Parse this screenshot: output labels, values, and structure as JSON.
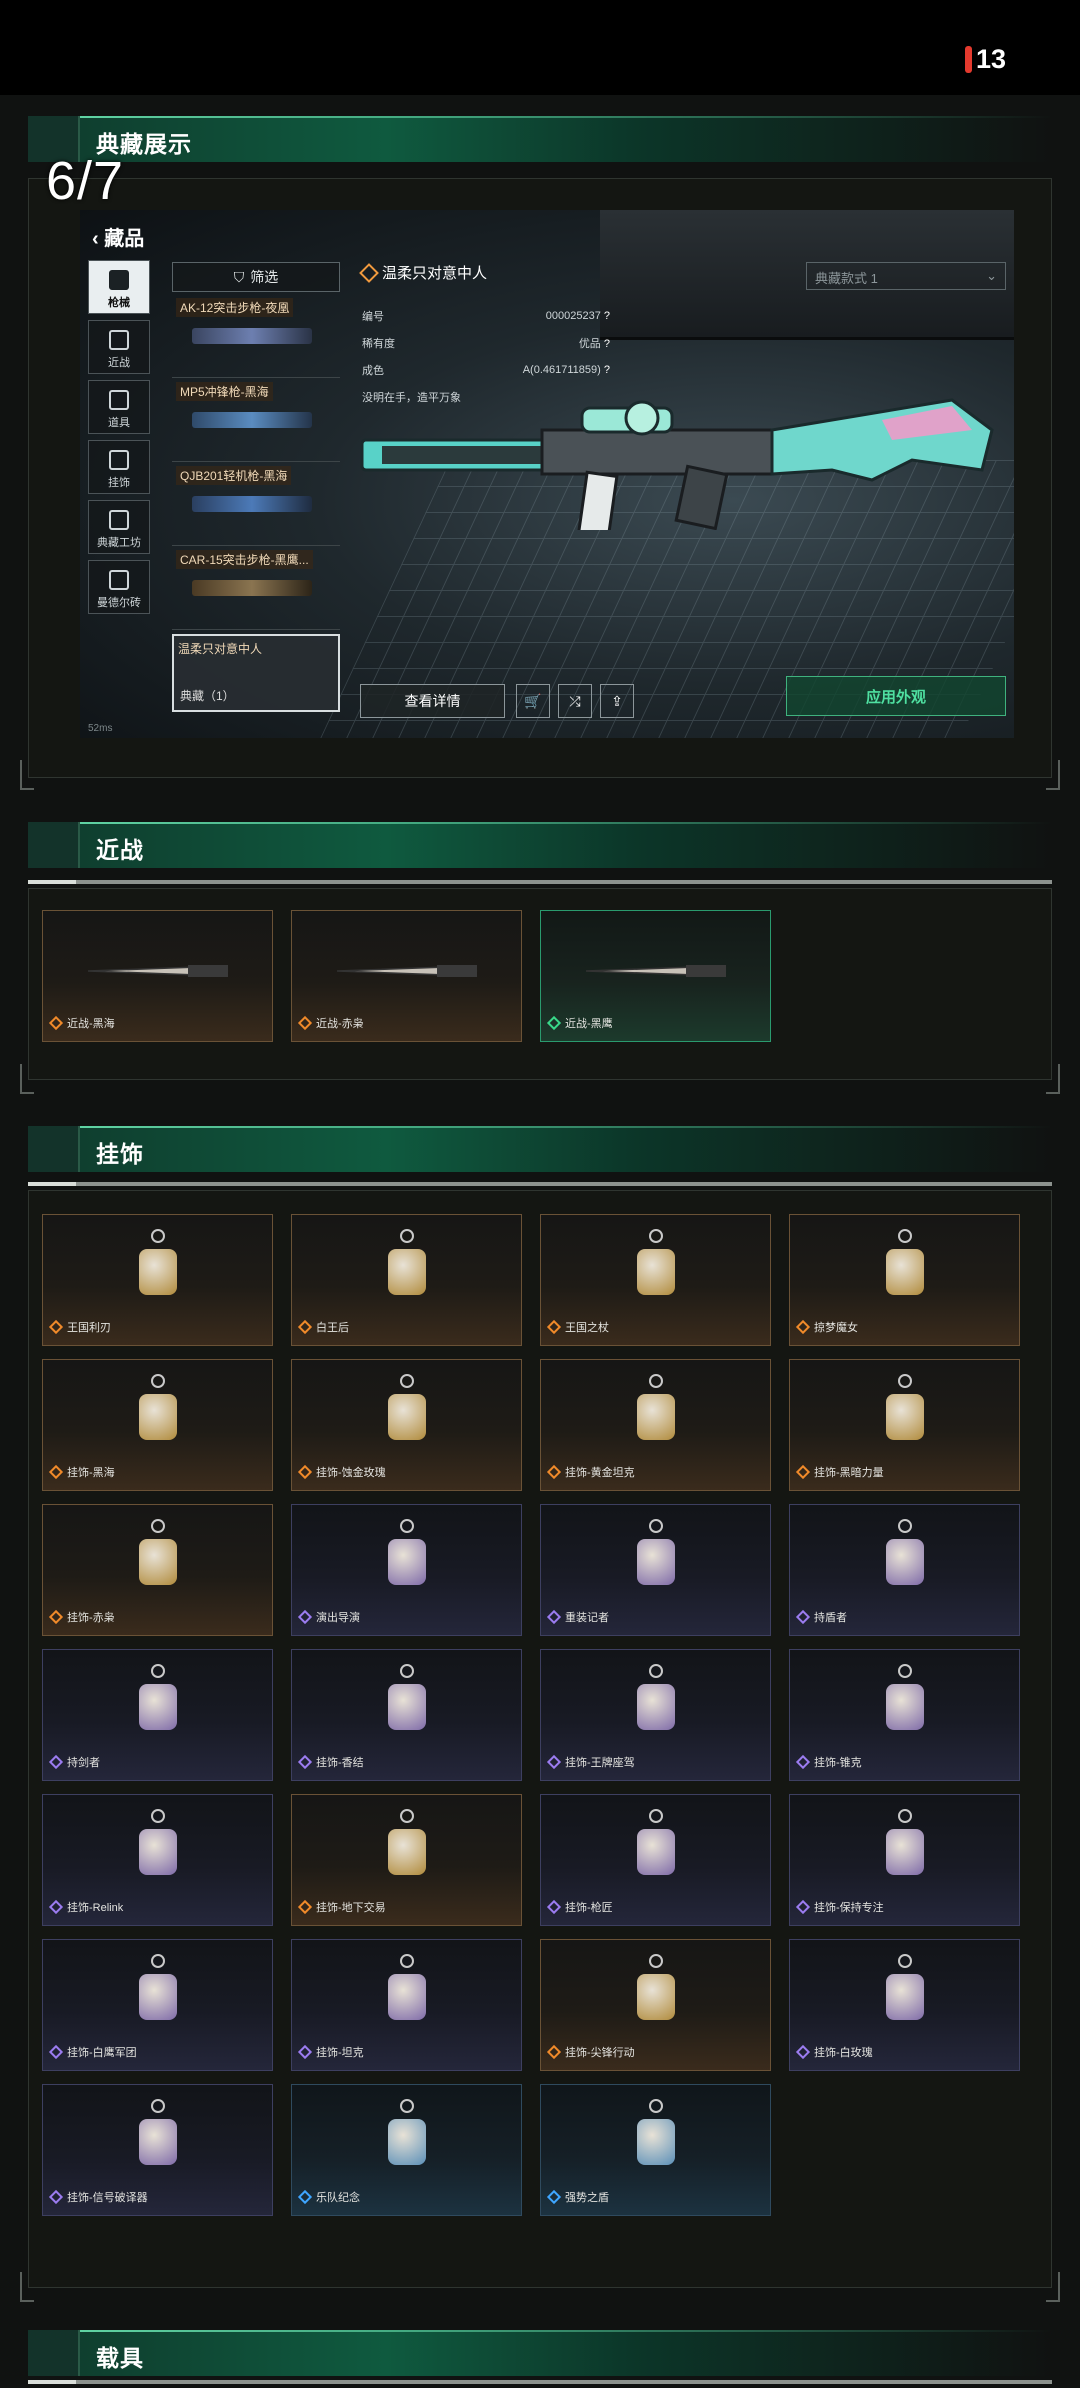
{
  "status": {
    "battery": "13"
  },
  "collection": {
    "title": "典藏展示",
    "counter": "6/7",
    "game": {
      "back_label": "藏品",
      "categories": [
        "枪械",
        "近战",
        "道具",
        "挂饰",
        "典藏工坊",
        "曼德尔砖"
      ],
      "filter_label": "筛选",
      "weapons": [
        "AK-12突击步枪-夜凰",
        "MP5冲锋枪-黑海",
        "QJB201轻机枪-黑海",
        "CAR-15突击步枪-黑鹰..."
      ],
      "selected_weapon": {
        "name": "温柔只对意中人",
        "count": "典藏（1）"
      },
      "skin_title": "温柔只对意中人",
      "info": [
        {
          "label": "编号",
          "value": "000025237"
        },
        {
          "label": "稀有度",
          "value": "优品"
        },
        {
          "label": "成色",
          "value": "A(0.461711859)"
        }
      ],
      "quote": "没明在手，造平万象",
      "skin_dropdown": "典藏款式 1",
      "details_button": "查看详情",
      "apply_button": "应用外观",
      "fps": "52ms"
    }
  },
  "melee": {
    "title": "近战",
    "items": [
      {
        "label": "近战-黑海",
        "rarity": "gold"
      },
      {
        "label": "近战-赤枭",
        "rarity": "gold"
      },
      {
        "label": "近战-黑鹰",
        "rarity": "green"
      }
    ]
  },
  "charms": {
    "title": "挂饰",
    "items": [
      {
        "label": "王国利刃",
        "rarity": "gold"
      },
      {
        "label": "白王后",
        "rarity": "gold"
      },
      {
        "label": "王国之杖",
        "rarity": "gold"
      },
      {
        "label": "掠梦魔女",
        "rarity": "gold"
      },
      {
        "label": "挂饰-黑海",
        "rarity": "gold"
      },
      {
        "label": "挂饰-蚀金玫瑰",
        "rarity": "gold"
      },
      {
        "label": "挂饰-黄金坦克",
        "rarity": "gold"
      },
      {
        "label": "挂饰-黑暗力量",
        "rarity": "gold"
      },
      {
        "label": "挂饰-赤枭",
        "rarity": "gold"
      },
      {
        "label": "演出导演",
        "rarity": "purple"
      },
      {
        "label": "重装记者",
        "rarity": "purple"
      },
      {
        "label": "持盾者",
        "rarity": "purple"
      },
      {
        "label": "持剑者",
        "rarity": "purple"
      },
      {
        "label": "挂饰-香结",
        "rarity": "purple"
      },
      {
        "label": "挂饰-王牌座驾",
        "rarity": "purple"
      },
      {
        "label": "挂饰-锥克",
        "rarity": "purple"
      },
      {
        "label": "挂饰-Relink",
        "rarity": "purple"
      },
      {
        "label": "挂饰-地下交易",
        "rarity": "gold"
      },
      {
        "label": "挂饰-枪匠",
        "rarity": "purple"
      },
      {
        "label": "挂饰-保持专注",
        "rarity": "purple"
      },
      {
        "label": "挂饰-白鹰军团",
        "rarity": "purple"
      },
      {
        "label": "挂饰-坦克",
        "rarity": "purple"
      },
      {
        "label": "挂饰-尖锋行动",
        "rarity": "gold"
      },
      {
        "label": "挂饰-白玫瑰",
        "rarity": "purple"
      },
      {
        "label": "挂饰-信号破译器",
        "rarity": "purple"
      },
      {
        "label": "乐队纪念",
        "rarity": "blue"
      },
      {
        "label": "强势之盾",
        "rarity": "blue"
      }
    ]
  },
  "vehicles": {
    "title": "载具"
  },
  "colors": {
    "accent": "#3fb27e",
    "gold": "#f08a2a",
    "purple": "#9b7cf0",
    "blue": "#3fa6ff",
    "green": "#39d98a"
  }
}
